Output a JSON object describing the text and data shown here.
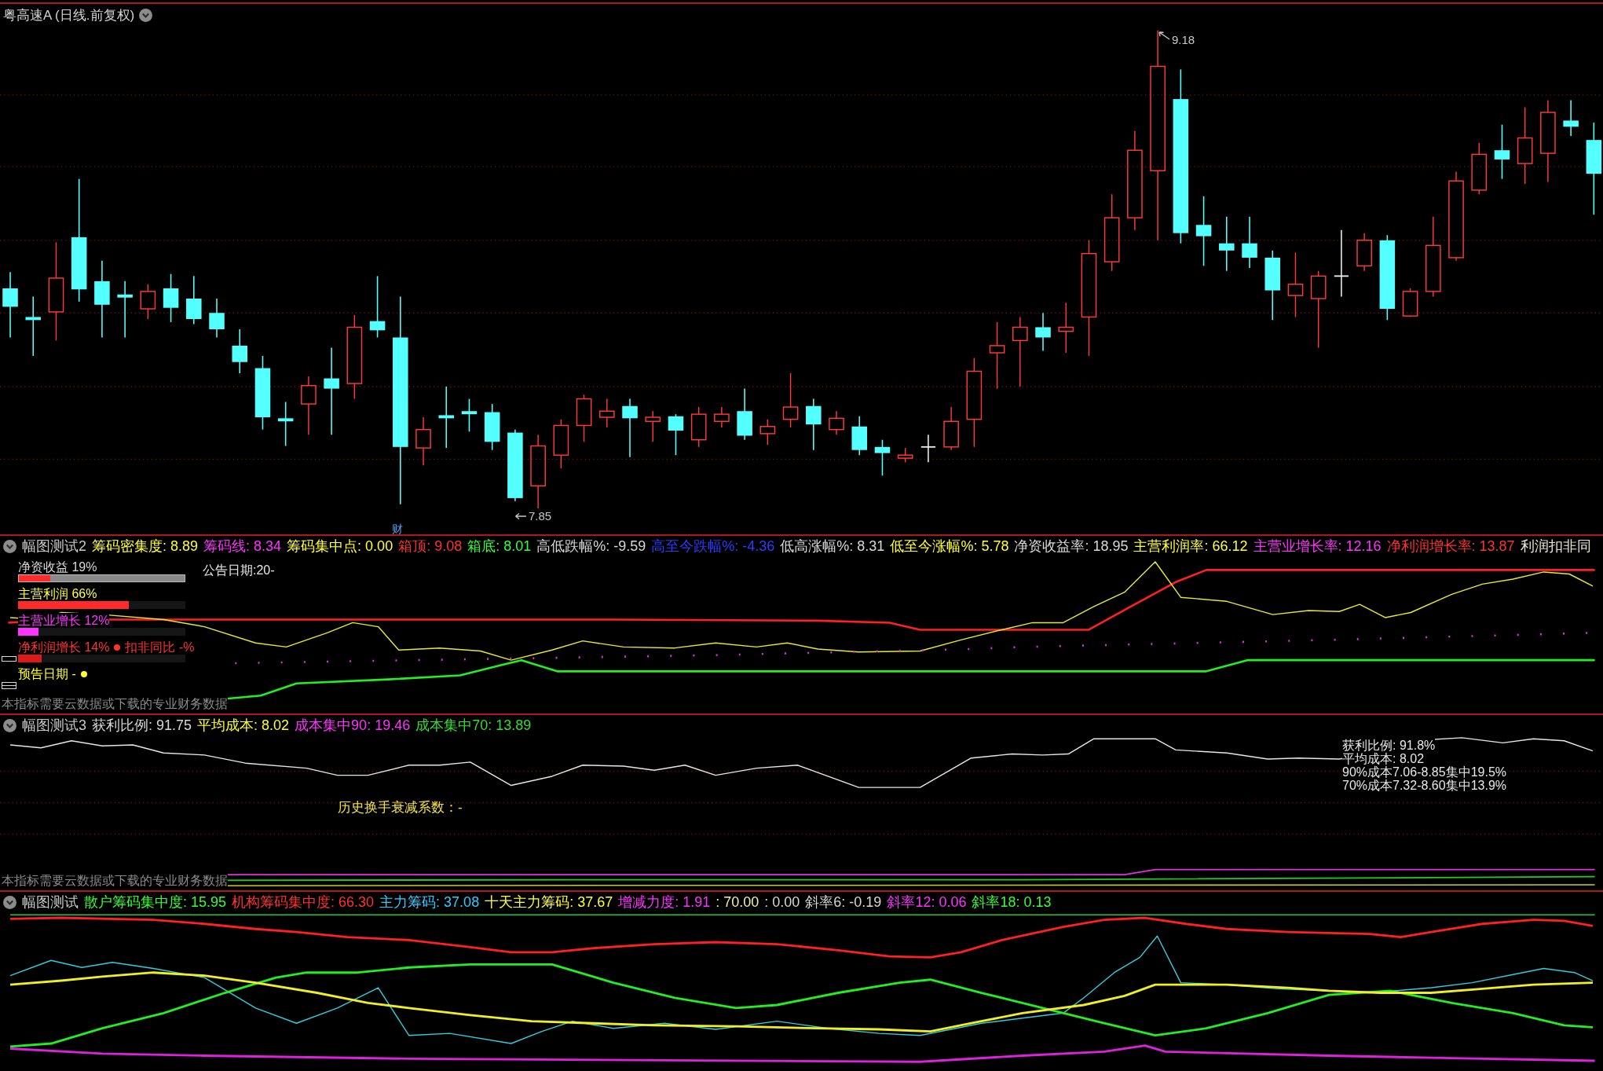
{
  "chart_title": "粤高速A (日线.前复权)",
  "price_chart": {
    "high_label": "9.18",
    "low_label": "7.85",
    "event_marker": "财"
  },
  "indicator_panels": [
    {
      "kind": "finance",
      "title": "幅图测试2",
      "readouts": [
        {
          "text": "筹码密集度: 8.89",
          "color": "#ffff33"
        },
        {
          "text": "筹码线: 8.34",
          "color": "#ff33ff"
        },
        {
          "text": "筹码集中点: 0.00",
          "color": "#ffff33"
        },
        {
          "text": "箱顶: 9.08",
          "color": "#ff3232"
        },
        {
          "text": "箱底: 8.01",
          "color": "#33ff33"
        },
        {
          "text": "高低跌幅%: -9.59",
          "color": "#d8d8d8"
        },
        {
          "text": "高至今跌幅%: -4.36",
          "color": "#2a3cff"
        },
        {
          "text": "低高涨幅%: 8.31",
          "color": "#d8d8d8"
        },
        {
          "text": "低至今涨幅%: 5.78",
          "color": "#ffff33"
        },
        {
          "text": "净资收益率: 18.95",
          "color": "#d8d8d8"
        },
        {
          "text": "主营利润率: 66.12",
          "color": "#ffff33"
        },
        {
          "text": "主营业增长率: 12.16",
          "color": "#ff33ff"
        },
        {
          "text": "净利润增长率: 13.87",
          "color": "#ff3232"
        },
        {
          "text": "利润扣非同",
          "color": "#e8e8d0"
        }
      ],
      "metrics": [
        {
          "kind": "bar",
          "label": "净资收益 19%",
          "color": "#d8d8d8",
          "bar": {
            "level": 0.19,
            "color": "#ff2a2a",
            "track": true
          }
        },
        {
          "kind": "bar",
          "label": "主营利润 66%",
          "color": "#ffff33",
          "bar": {
            "level": 0.66,
            "color": "#ff2a2a",
            "track": false
          }
        },
        {
          "kind": "bar",
          "label": "主营业增长 12%",
          "color": "#ff33ff",
          "bar": {
            "level": 0.12,
            "color": "#ff33ff",
            "track": false
          }
        },
        {
          "kind": "bar",
          "label": "净利润增长 14%",
          "color": "#ff3232",
          "note": "扣非同比 -%",
          "bar": {
            "level": 0.14,
            "color": "#dd1a1a",
            "track": false
          }
        },
        {
          "kind": "date",
          "label": "预告日期 -",
          "color": "#ffff33"
        }
      ],
      "notice_date": "公告日期:20-",
      "footnote": "本指标需要云数据或下载的专业财务数据"
    },
    {
      "kind": "cost",
      "title": "幅图测试3",
      "readouts": [
        {
          "text": "获利比例: 91.75",
          "color": "#d8d8d8"
        },
        {
          "text": "平均成本: 8.02",
          "color": "#ffff33"
        },
        {
          "text": "成本集中90: 19.46",
          "color": "#ff33ff"
        },
        {
          "text": "成本集中70: 13.89",
          "color": "#33dd33"
        }
      ],
      "decay_label": "历史换手衰减系数：-",
      "summary": [
        "获利比例: 91.8%",
        "平均成本: 8.02",
        "90%成本7.06-8.85集中19.5%",
        "70%成本7.32-8.60集中13.9%"
      ],
      "footnote": "本指标需要云数据或下载的专业财务数据"
    },
    {
      "kind": "chip",
      "title": "幅图测试",
      "readouts": [
        {
          "text": "散户筹码集中度: 15.95",
          "color": "#33ff33"
        },
        {
          "text": "机构筹码集中度: 66.30",
          "color": "#ff3232"
        },
        {
          "text": "主力筹码: 37.08",
          "color": "#33ccff"
        },
        {
          "text": "十天主力筹码: 37.67",
          "color": "#ffff33"
        },
        {
          "text": "增减力度: 1.91",
          "color": "#ff33ff"
        },
        {
          "text": ": 70.00",
          "color": "#f0f0a0"
        },
        {
          "text": ": 0.00",
          "color": "#d8d8d8"
        },
        {
          "text": "斜率6: -0.19",
          "color": "#d8d8d8"
        },
        {
          "text": "斜率12: 0.06",
          "color": "#ff33ff"
        },
        {
          "text": "斜率18: 0.13",
          "color": "#33ff33"
        }
      ]
    }
  ]
}
